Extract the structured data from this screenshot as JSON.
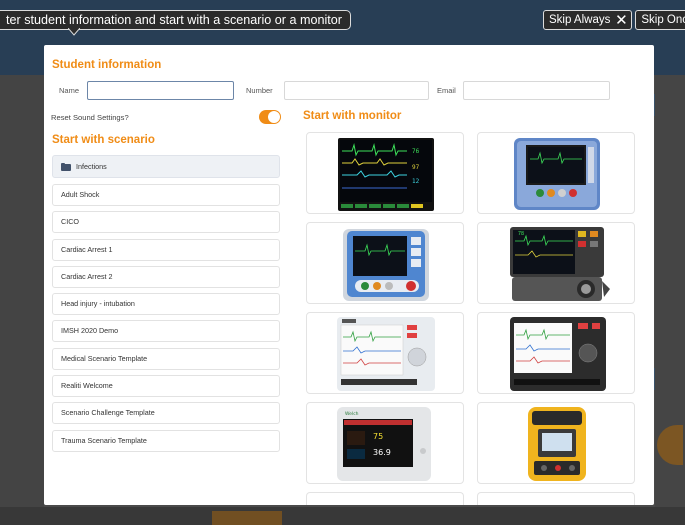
{
  "tour": {
    "message": "ter student information and start with a scenario or a monitor",
    "skip_always": "Skip Always",
    "close": "✕",
    "skip_once": "Skip Once"
  },
  "student": {
    "heading": "Student information",
    "name_label": "Name",
    "name_value": "",
    "number_label": "Number",
    "number_value": "",
    "email_label": "Email",
    "email_value": "",
    "reset_sound_label": "Reset Sound Settings?",
    "reset_sound_on": true
  },
  "scenario": {
    "heading": "Start with scenario",
    "items": [
      {
        "label": "Infections",
        "type": "folder"
      },
      {
        "label": "Adult Shock"
      },
      {
        "label": "CICO"
      },
      {
        "label": "Cardiac Arrest 1"
      },
      {
        "label": "Cardiac Arrest 2"
      },
      {
        "label": "Head injury - intubation"
      },
      {
        "label": "IMSH 2020 Demo"
      },
      {
        "label": "Medical Scenario Template"
      },
      {
        "label": "Realiti Welcome"
      },
      {
        "label": "Scenario Challenge Template"
      },
      {
        "label": "Trauma Scenario Template"
      }
    ]
  },
  "monitor": {
    "heading": "Start with monitor",
    "devices": [
      {
        "icon": "patient-monitor-dark-icon"
      },
      {
        "icon": "blue-monitor-defibrillator-icon"
      },
      {
        "icon": "blue-defibrillator-icon"
      },
      {
        "icon": "monitor-defibrillator-dial-icon"
      },
      {
        "icon": "white-defibrillator-icon"
      },
      {
        "icon": "black-defibrillator-icon"
      },
      {
        "icon": "vital-signs-monitor-icon"
      },
      {
        "icon": "yellow-aed-icon"
      }
    ],
    "readouts": {
      "value_a": "75",
      "value_b": "36.9"
    }
  },
  "colors": {
    "accent": "#f08c16",
    "folder": "#41516a",
    "overlay_bar": "#2b2b2b"
  }
}
